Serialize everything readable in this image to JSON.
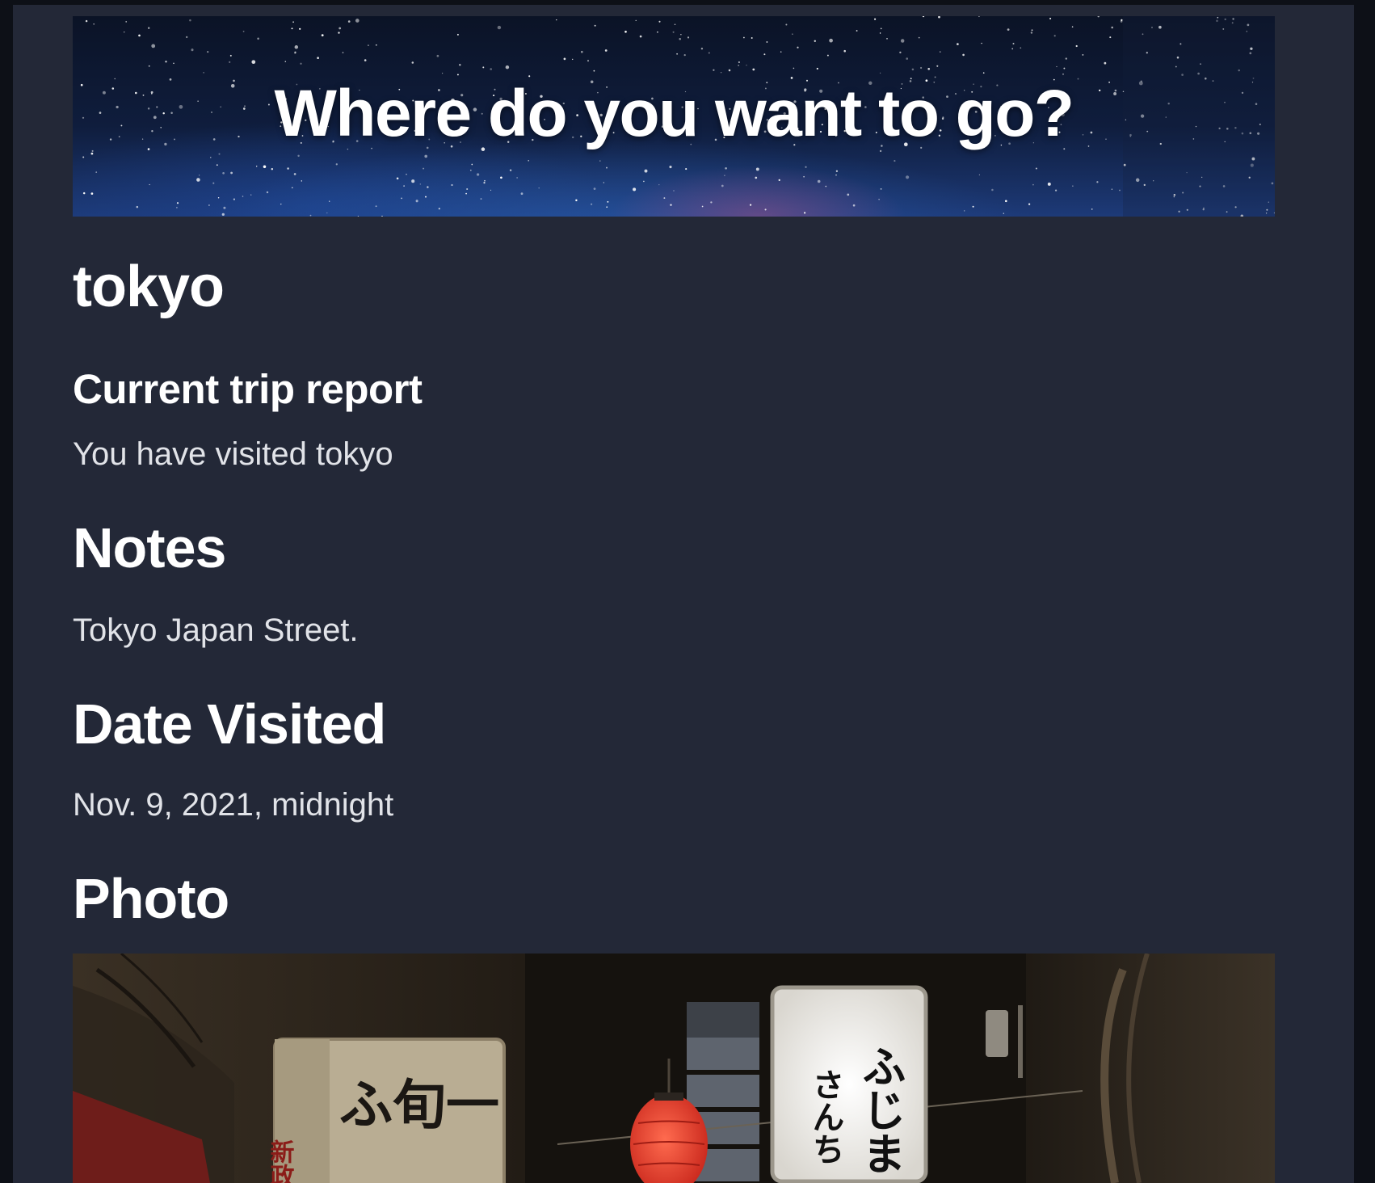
{
  "hero": {
    "heading": "Where do you want to go?"
  },
  "trip": {
    "place": "tokyo",
    "report_heading": "Current trip report",
    "visited_text": "You have visited tokyo",
    "notes_heading": "Notes",
    "notes_text": "Tokyo Japan Street.",
    "date_heading": "Date Visited",
    "date_text": "Nov. 9, 2021, midnight",
    "photo_heading": "Photo"
  },
  "photo": {
    "sign_left_chars": "ふ旬一",
    "sign_left_side": "新政",
    "sign_right_col1": "ふじま",
    "sign_right_col2": "さんち"
  },
  "colors": {
    "page_bg": "#232837",
    "outer_bg": "#0d1017",
    "heading": "#ffffff",
    "body_text": "#e1e3e8",
    "lantern": "#e2372a"
  }
}
